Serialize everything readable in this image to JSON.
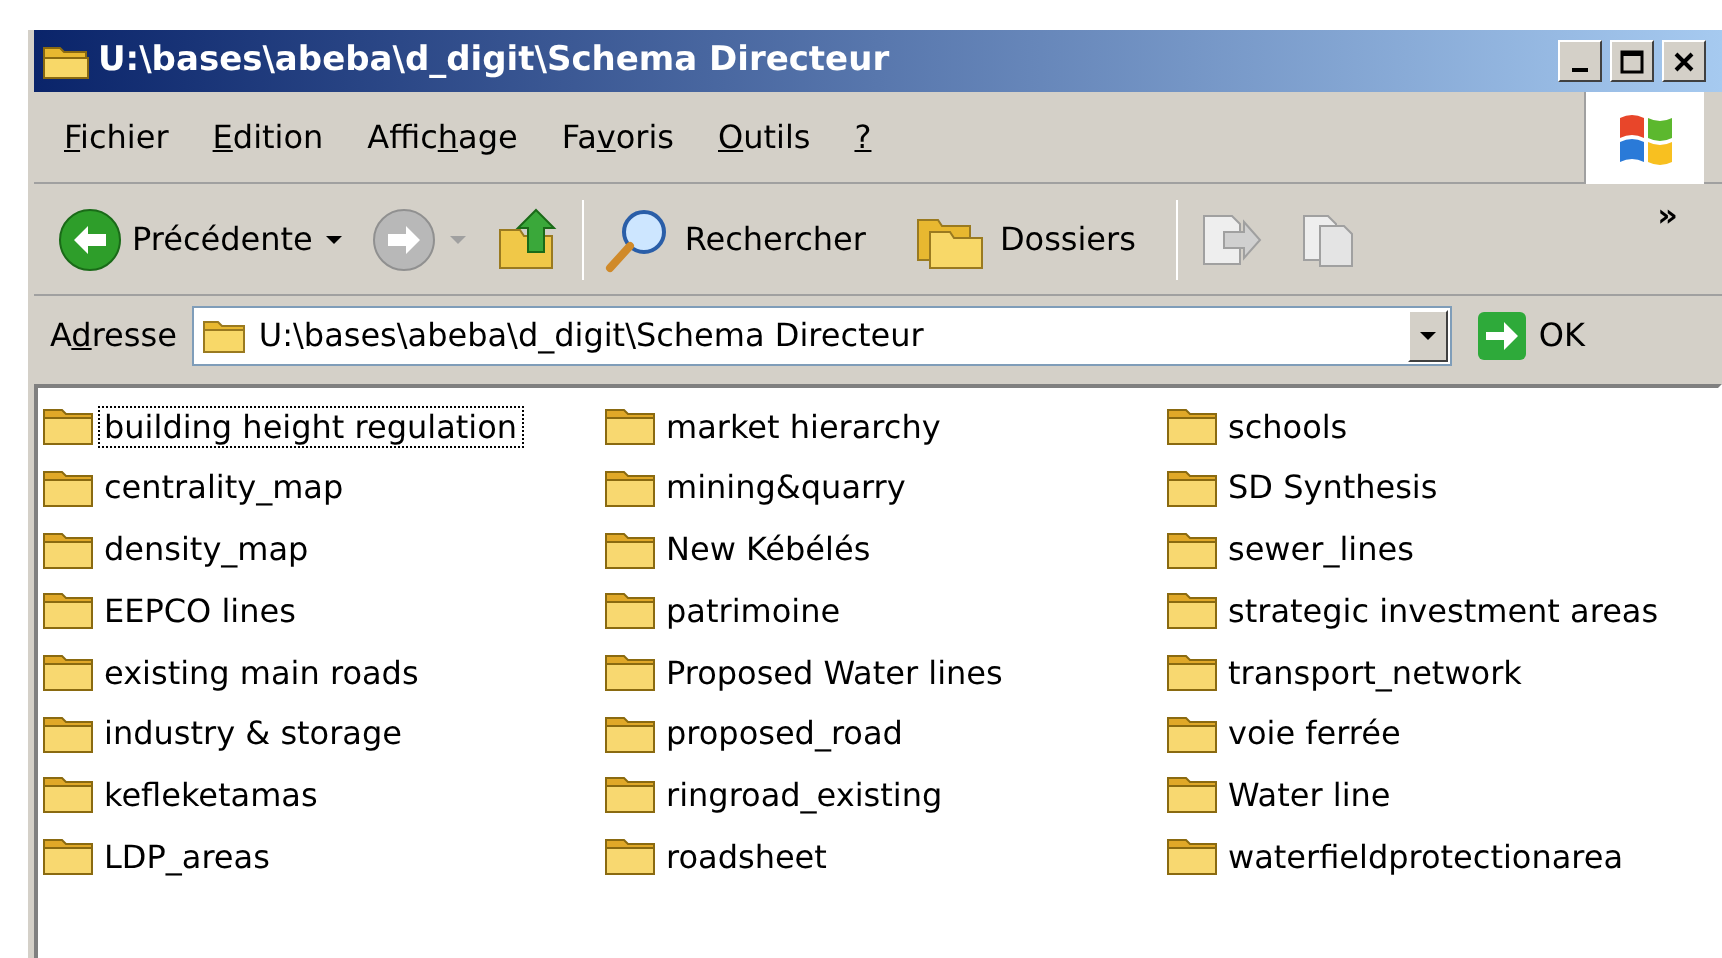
{
  "window": {
    "title": "U:\\bases\\abeba\\d_digit\\Schema Directeur"
  },
  "menu": [
    {
      "key": "F",
      "after": "ichier"
    },
    {
      "key": "E",
      "after": "dition"
    },
    {
      "before": "Affic",
      "key": "h",
      "after": "age"
    },
    {
      "before": "Fa",
      "key": "v",
      "after": "oris"
    },
    {
      "key": "O",
      "after": "utils"
    },
    {
      "key": "?"
    }
  ],
  "toolbar": {
    "back_label": "Précédente",
    "search_label": "Rechercher",
    "folders_label": "Dossiers",
    "overflow": "»",
    "forward_disabled": true
  },
  "address": {
    "label": {
      "before": "A",
      "key": "d",
      "after": "resse"
    },
    "value": "U:\\bases\\abeba\\d_digit\\Schema Directeur",
    "go_label": "OK"
  },
  "folders": [
    {
      "name": "building height regulation",
      "focused": true
    },
    {
      "name": "centrality_map",
      "focused": false
    },
    {
      "name": "density_map",
      "focused": false
    },
    {
      "name": "EEPCO lines",
      "focused": false
    },
    {
      "name": "existing main roads",
      "focused": false
    },
    {
      "name": "industry & storage",
      "focused": false
    },
    {
      "name": "kefleketamas",
      "focused": false
    },
    {
      "name": "LDP_areas",
      "focused": false
    },
    {
      "name": "market hierarchy",
      "focused": false
    },
    {
      "name": "mining&quarry",
      "focused": false
    },
    {
      "name": "New Kébélés",
      "focused": false
    },
    {
      "name": "patrimoine",
      "focused": false
    },
    {
      "name": "Proposed Water lines",
      "focused": false
    },
    {
      "name": "proposed_road",
      "focused": false
    },
    {
      "name": "ringroad_existing",
      "focused": false
    },
    {
      "name": "roadsheet",
      "focused": false
    },
    {
      "name": "schools",
      "focused": false
    },
    {
      "name": "SD Synthesis",
      "focused": false
    },
    {
      "name": "sewer_lines",
      "focused": false
    },
    {
      "name": "strategic investment areas",
      "focused": false
    },
    {
      "name": "transport_network",
      "focused": false
    },
    {
      "name": "voie ferrée",
      "focused": false
    },
    {
      "name": "Water line",
      "focused": false
    },
    {
      "name": "waterfieldprotectionarea",
      "focused": false
    }
  ]
}
